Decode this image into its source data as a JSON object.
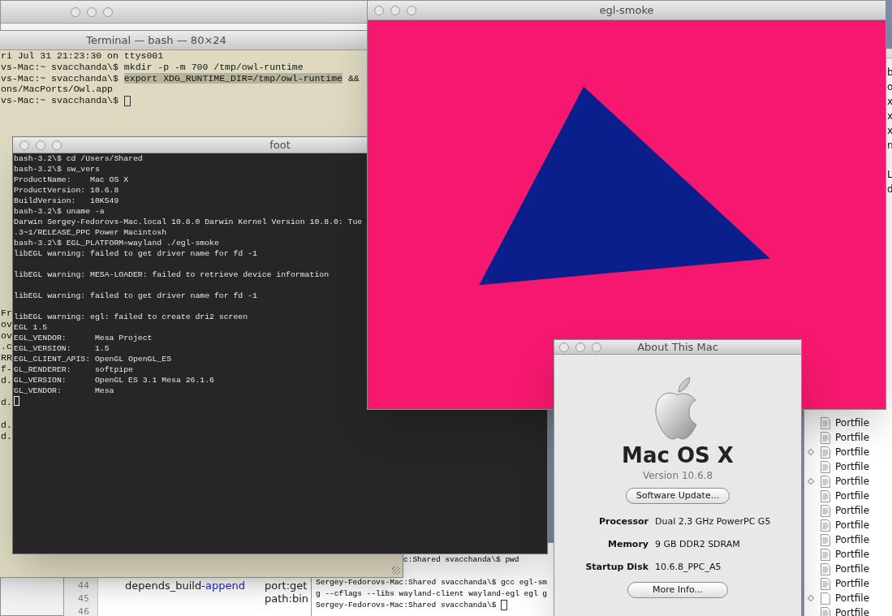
{
  "editor": {
    "lines": [
      {
        "number": "44",
        "tokens": [
          {
            "text": "depends_build-",
            "kind": "plain"
          },
          {
            "text": "append",
            "kind": "keyword"
          }
        ],
        "value": "port:get"
      },
      {
        "number": "45",
        "value": "path:bin"
      },
      {
        "number": "46"
      }
    ]
  },
  "background_terminal": {
    "lines": [
      {
        "text": "c:Shared svacchanda\\$ pwd",
        "kind": "tail"
      },
      {
        "text": "Sergey-Fedorovs-Mac:Shared svacchanda\\$ gcc egl-sm",
        "kind": "full"
      },
      {
        "text": "g --cflags --libs wayland-client wayland-egl egl g",
        "kind": "full"
      },
      {
        "text": "Sergey-Fedorovs-Mac:Shared svacchanda\\$ ",
        "kind": "full",
        "cursor": true
      }
    ]
  },
  "terminal": {
    "title": "Terminal — bash — 80×24",
    "lines": [
      {
        "text": "ri Jul 31 21:23:30 on ttys001"
      },
      {
        "text": "vs-Mac:~ svacchanda\\$ mkdir -p -m 700 /tmp/owl-runtime"
      },
      {
        "text": "vs-Mac:~ svacchanda\\$ ",
        "selection": "export XDG_RUNTIME_DIR=/tmp/owl-runtime",
        "after": " &&"
      },
      {
        "text": "ons/MacPorts/Owl.app"
      },
      {
        "text": "vs-Mac:~ svacchanda\\$ ",
        "cursor": true
      }
    ],
    "fragment_groups": [
      [
        "Fr",
        "ov",
        "ov",
        ".c",
        "RR",
        "f-",
        "d."
      ],
      [
        "d."
      ],
      [
        "d.",
        "d."
      ]
    ]
  },
  "portfile_window": {
    "fragment_groups": [
      [
        "b",
        "o",
        "x",
        "x",
        "x",
        "n"
      ],
      [
        "L",
        "d"
      ]
    ],
    "files": [
      {
        "name": "Portfile",
        "kind": "doc",
        "diamond": false
      },
      {
        "name": "Portfile",
        "kind": "doc",
        "diamond": false
      },
      {
        "name": "Portfile",
        "kind": "doc",
        "diamond": true
      },
      {
        "name": "Portfile",
        "kind": "doc",
        "diamond": false
      },
      {
        "name": "Portfile",
        "kind": "doc",
        "diamond": true
      },
      {
        "name": "Portfile",
        "kind": "doc",
        "diamond": false
      },
      {
        "name": "Portfile",
        "kind": "doc",
        "diamond": false
      },
      {
        "name": "Portfile",
        "kind": "doc",
        "diamond": false
      },
      {
        "name": "Portfile",
        "kind": "doc",
        "diamond": false
      },
      {
        "name": "Portfile",
        "kind": "doc",
        "diamond": false
      },
      {
        "name": "Portfile",
        "kind": "doc",
        "diamond": false
      },
      {
        "name": "Portfile",
        "kind": "doc",
        "diamond": false
      },
      {
        "name": "Portfile",
        "kind": "blank",
        "diamond": true
      },
      {
        "name": "Portfile",
        "kind": "doc",
        "diamond": false
      }
    ]
  },
  "foot": {
    "title": "foot",
    "cursor": true,
    "blocks": [
      [
        "bash-3.2\\$ cd /Users/Shared",
        "bash-3.2\\$ sw_vers",
        "ProductName:    Mac OS X",
        "ProductVersion: 10.6.8",
        "BuildVersion:   10K549",
        "bash-3.2\\$ uname -a",
        "Darwin Sergey-Fedorovs-Mac.local 10.8.0 Darwin Kernel Version 10.8.0: Tue",
        ".3~1/RELEASE_PPC Power Macintosh",
        "bash-3.2\\$ EGL_PLATFORM=wayland ./egl-smoke",
        "libEGL warning: failed to get driver name for fd -1"
      ],
      [
        "libEGL warning: MESA-LOADER: failed to retrieve device information"
      ],
      [
        "libEGL warning: failed to get driver name for fd -1"
      ],
      [
        "libEGL warning: egl: failed to create dri2 screen",
        "EGL 1.5",
        "EGL_VENDOR:      Mesa Project",
        "EGL_VERSION:     1.5",
        "EGL_CLIENT_APIS: OpenGL OpenGL_ES",
        "GL_RENDERER:     softpipe",
        "GL_VERSION:      OpenGL ES 3.1 Mesa 26.1.6",
        "GL_VENDOR:       Mesa"
      ]
    ]
  },
  "egl_smoke": {
    "title": "egl-smoke"
  },
  "about": {
    "title": "About This Mac",
    "product": "Mac OS X",
    "version": "Version 10.6.8",
    "buttons": [
      "Software Update...",
      "More Info..."
    ],
    "specs": [
      {
        "label": "Processor",
        "value": "Dual 2.3 GHz PowerPC G5"
      },
      {
        "label": "Memory",
        "value": "9 GB DDR2 SDRAM"
      },
      {
        "label": "Startup Disk",
        "value": "10.6.8_PPC_A5"
      }
    ]
  }
}
